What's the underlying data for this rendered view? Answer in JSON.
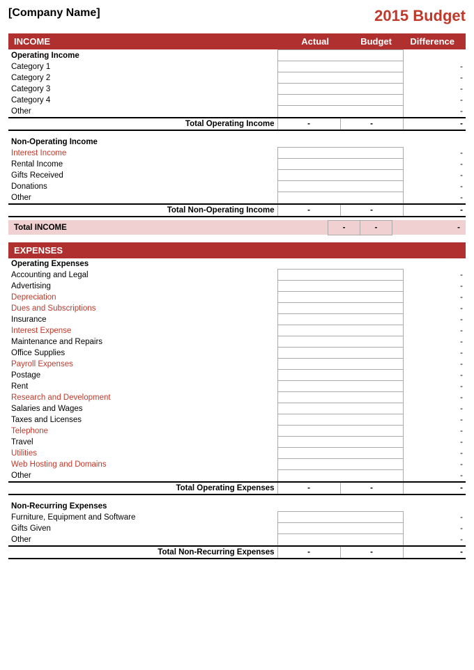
{
  "header": {
    "company_name": "[Company Name]",
    "budget_title": "2015 Budget"
  },
  "income_section": {
    "label": "INCOME",
    "col_actual": "Actual",
    "col_budget": "Budget",
    "col_difference": "Difference",
    "operating_income": {
      "label": "Operating Income",
      "items": [
        {
          "label": "Category 1",
          "red": false
        },
        {
          "label": "Category 2",
          "red": false
        },
        {
          "label": "Category 3",
          "red": false
        },
        {
          "label": "Category 4",
          "red": false
        },
        {
          "label": "Other",
          "red": false
        }
      ],
      "total_label": "Total Operating Income",
      "total_actual": "-",
      "total_budget": "-",
      "total_diff": "-"
    },
    "non_operating_income": {
      "label": "Non-Operating Income",
      "items": [
        {
          "label": "Interest Income",
          "red": true
        },
        {
          "label": "Rental Income",
          "red": false
        },
        {
          "label": "Gifts Received",
          "red": false
        },
        {
          "label": "Donations",
          "red": false
        },
        {
          "label": "Other",
          "red": false
        }
      ],
      "total_label": "Total Non-Operating Income",
      "total_actual": "-",
      "total_budget": "-",
      "total_diff": "-"
    },
    "grand_total_label": "Total INCOME",
    "grand_total_actual": "-",
    "grand_total_budget": "-",
    "grand_total_diff": "-"
  },
  "expenses_section": {
    "label": "EXPENSES",
    "operating_expenses": {
      "label": "Operating Expenses",
      "items": [
        {
          "label": "Accounting and Legal",
          "red": false
        },
        {
          "label": "Advertising",
          "red": false
        },
        {
          "label": "Depreciation",
          "red": true
        },
        {
          "label": "Dues and Subscriptions",
          "red": true
        },
        {
          "label": "Insurance",
          "red": false
        },
        {
          "label": "Interest Expense",
          "red": true
        },
        {
          "label": "Maintenance and Repairs",
          "red": false
        },
        {
          "label": "Office Supplies",
          "red": false
        },
        {
          "label": "Payroll Expenses",
          "red": true
        },
        {
          "label": "Postage",
          "red": false
        },
        {
          "label": "Rent",
          "red": false
        },
        {
          "label": "Research and Development",
          "red": true
        },
        {
          "label": "Salaries and Wages",
          "red": false
        },
        {
          "label": "Taxes and Licenses",
          "red": false
        },
        {
          "label": "Telephone",
          "red": true
        },
        {
          "label": "Travel",
          "red": false
        },
        {
          "label": "Utilities",
          "red": true
        },
        {
          "label": "Web Hosting and Domains",
          "red": true
        },
        {
          "label": "Other",
          "red": false
        }
      ],
      "total_label": "Total Operating Expenses",
      "total_actual": "-",
      "total_budget": "-",
      "total_diff": "-"
    },
    "non_recurring_expenses": {
      "label": "Non-Recurring Expenses",
      "items": [
        {
          "label": "Furniture, Equipment and Software",
          "red": false
        },
        {
          "label": "Gifts Given",
          "red": false
        },
        {
          "label": "Other",
          "red": false
        }
      ],
      "total_label": "Total Non-Recurring Expenses",
      "total_actual": "-",
      "total_budget": "-",
      "total_diff": "-"
    }
  },
  "dash": "-"
}
